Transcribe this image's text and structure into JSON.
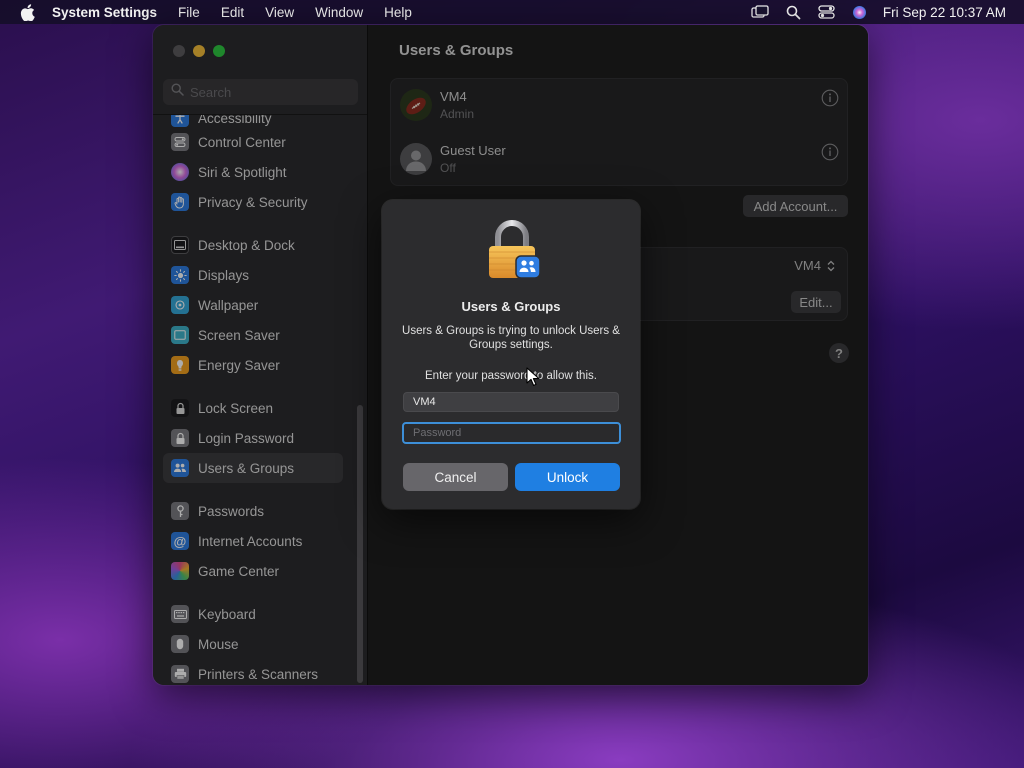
{
  "menubar": {
    "app_name": "System Settings",
    "menus": [
      "File",
      "Edit",
      "View",
      "Window",
      "Help"
    ],
    "clock": "Fri Sep 22  10:37 AM",
    "status_icons": [
      "screen-mirroring-icon",
      "spotlight-search-icon",
      "control-center-icon",
      "siri-icon"
    ]
  },
  "sidebar": {
    "search_placeholder": "Search",
    "items": [
      {
        "label": "Accessibility",
        "icon": "accessibility-icon",
        "color": "#2f7de1"
      },
      {
        "label": "Control Center",
        "icon": "control-center-icon",
        "color": "#7b7b80"
      },
      {
        "label": "Siri & Spotlight",
        "icon": "siri-icon",
        "color": "#b048d8"
      },
      {
        "label": "Privacy & Security",
        "icon": "hand-icon",
        "color": "#2f7de1"
      },
      {
        "label": "Desktop & Dock",
        "icon": "dock-icon",
        "color": "#1d1d1f"
      },
      {
        "label": "Displays",
        "icon": "sun-icon",
        "color": "#2f7de1"
      },
      {
        "label": "Wallpaper",
        "icon": "wallpaper-icon",
        "color": "#35a7d8"
      },
      {
        "label": "Screen Saver",
        "icon": "screen-saver-icon",
        "color": "#3fb2c9"
      },
      {
        "label": "Energy Saver",
        "icon": "battery-icon",
        "color": "#f0a020"
      },
      {
        "label": "Lock Screen",
        "icon": "lock-icon",
        "color": "#1d1d1f"
      },
      {
        "label": "Login Password",
        "icon": "login-lock-icon",
        "color": "#7b7b80"
      },
      {
        "label": "Users & Groups",
        "icon": "users-icon",
        "color": "#2f7de1"
      },
      {
        "label": "Passwords",
        "icon": "key-icon",
        "color": "#7b7b80"
      },
      {
        "label": "Internet Accounts",
        "icon": "at-sign-icon",
        "color": "#2f7de1"
      },
      {
        "label": "Game Center",
        "icon": "game-center-icon",
        "color": "#e04f8a"
      },
      {
        "label": "Keyboard",
        "icon": "keyboard-icon",
        "color": "#7b7b80"
      },
      {
        "label": "Mouse",
        "icon": "mouse-icon",
        "color": "#7b7b80"
      },
      {
        "label": "Printers & Scanners",
        "icon": "printer-icon",
        "color": "#7b7b80"
      }
    ],
    "selected": "Users & Groups"
  },
  "main": {
    "title": "Users & Groups",
    "users": [
      {
        "name": "VM4",
        "role": "Admin"
      },
      {
        "name": "Guest User",
        "role": "Off"
      }
    ],
    "add_account_label": "Add Account...",
    "auto_login_value": "VM4",
    "edit_label": "Edit...",
    "help_label": "?"
  },
  "dialog": {
    "title": "Users & Groups",
    "message": "Users & Groups is trying to unlock Users & Groups settings.",
    "prompt": "Enter your password to allow this.",
    "username_value": "VM4",
    "password_placeholder": "Password",
    "cancel_label": "Cancel",
    "unlock_label": "Unlock"
  },
  "colors": {
    "accent": "#1f7fe2",
    "focus_ring": "#3d8fd8",
    "lock_gold": "#e8a93a"
  }
}
